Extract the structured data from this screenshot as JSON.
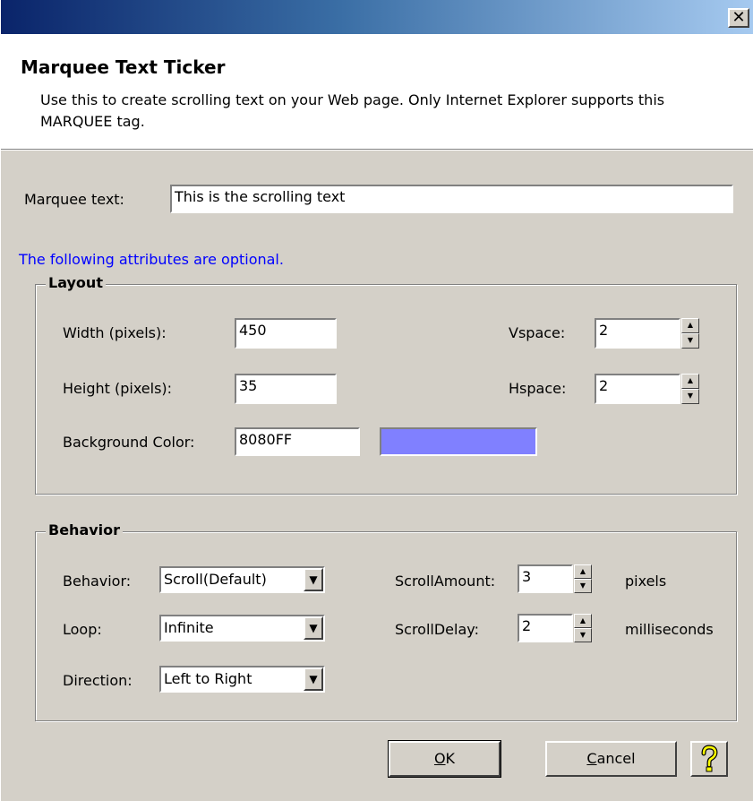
{
  "window": {
    "close_glyph": "✕"
  },
  "header": {
    "title": "Marquee Text Ticker",
    "description": "Use this to create scrolling text on your Web page.  Only Internet Explorer supports this MARQUEE tag."
  },
  "marquee_text": {
    "label": "Marquee text:",
    "value": "This is the scrolling text"
  },
  "optional_note": "The following attributes are optional.",
  "layout": {
    "group_title": "Layout",
    "width": {
      "label": "Width (pixels):",
      "value": "450"
    },
    "height": {
      "label": "Height (pixels):",
      "value": "35"
    },
    "vspace": {
      "label": "Vspace:",
      "value": "2"
    },
    "hspace": {
      "label": "Hspace:",
      "value": "2"
    },
    "background": {
      "label": "Background Color:",
      "value": "8080FF",
      "swatch_color": "#8080FF"
    }
  },
  "behavior": {
    "group_title": "Behavior",
    "behavior": {
      "label": "Behavior:",
      "selected": "Scroll(Default)"
    },
    "loop": {
      "label": "Loop:",
      "selected": "Infinite"
    },
    "direction": {
      "label": "Direction:",
      "selected": "Left to Right"
    },
    "scroll_amount": {
      "label": "ScrollAmount:",
      "value": "3",
      "unit": "pixels"
    },
    "scroll_delay": {
      "label": "ScrollDelay:",
      "value": "2",
      "unit": "milliseconds"
    }
  },
  "buttons": {
    "ok_mnemonic": "O",
    "ok_rest": "K",
    "cancel_mnemonic": "C",
    "cancel_rest": "ancel",
    "help_icon": "question-mark"
  },
  "colors": {
    "note_text": "#0000FF",
    "dialog_bg": "#D4D0C8"
  }
}
